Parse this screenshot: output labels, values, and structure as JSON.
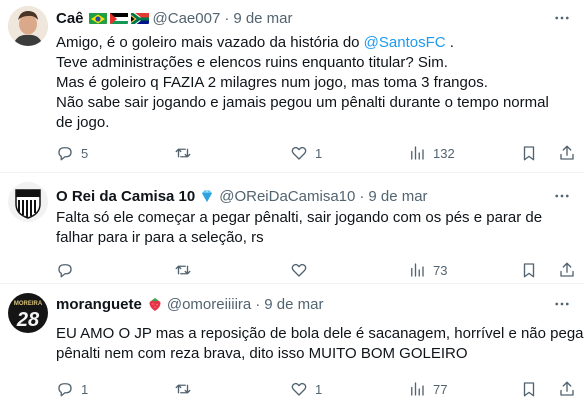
{
  "tweets": [
    {
      "name": "Caê",
      "handle": "@Cae007",
      "separator": "·",
      "date": "9 de mar",
      "lines": [
        {
          "before": "Amigo, é o goleiro mais vazado da história do ",
          "mention": "@SantosFC",
          "after": " ."
        },
        {
          "text": "Teve administrações e elencos ruins enquanto titular? Sim."
        },
        {
          "text": "Mas é goleiro q FAZIA 2 milagres num jogo, mas toma 3 frangos."
        },
        {
          "text": "Não sabe sair jogando e jamais pegou um pênalti durante o tempo normal"
        },
        {
          "text": "de jogo."
        }
      ],
      "replies": "5",
      "retweets": "",
      "likes": "1",
      "views": "132"
    },
    {
      "name": "O Rei da Camisa 10",
      "handle": "@OReiDaCamisa10",
      "separator": "·",
      "date": "9 de mar",
      "lines": [
        {
          "text": "Falta só ele começar a pegar pênalti, sair jogando com os pés e parar de"
        },
        {
          "text": "falhar para ir para a seleção, rs"
        }
      ],
      "replies": "",
      "retweets": "",
      "likes": "",
      "views": "73"
    },
    {
      "name": "moranguete",
      "handle": "@omoreiiiira",
      "separator": "·",
      "date": "9 de mar",
      "lines": [
        {
          "text": "EU AMO O JP mas a reposição de bola dele é sacanagem, horrível e não pega"
        },
        {
          "text": "pênalti nem com reza brava, dito isso MUITO BOM GOLEIRO"
        }
      ],
      "replies": "1",
      "retweets": "",
      "likes": "1",
      "views": "77"
    }
  ],
  "avatar3_text": "28",
  "avatar3_sub": "MOREIRA",
  "colors": {
    "accent": "#1d9bf0",
    "secondary": "#536471",
    "text": "#0f1419",
    "divider": "#eff3f4"
  },
  "icons": [
    "reply-icon",
    "retweet-icon",
    "like-icon",
    "views-icon",
    "bookmark-icon",
    "share-icon",
    "more-icon"
  ]
}
